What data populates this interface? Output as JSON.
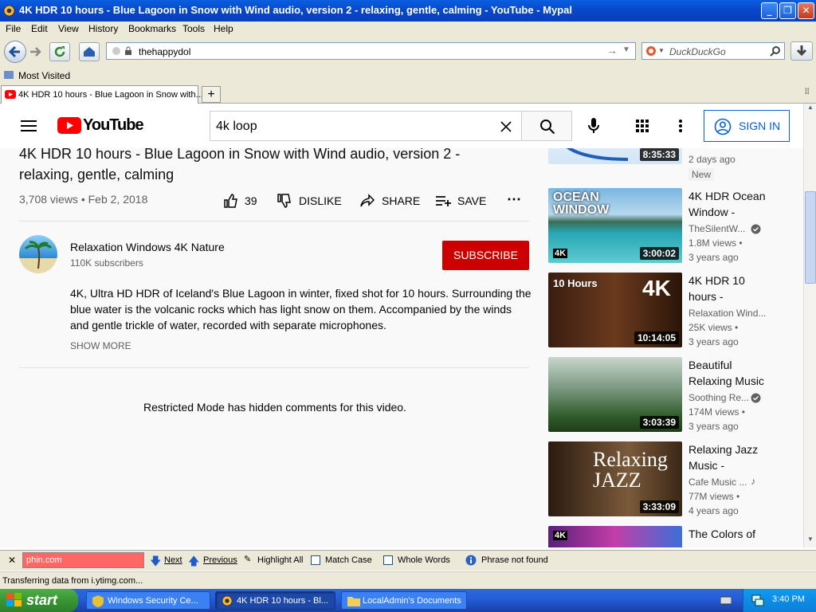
{
  "window": {
    "title": "4K HDR 10 hours - Blue Lagoon in Snow with Wind audio, version 2 - relaxing, gentle, calming - YouTube - Mypal"
  },
  "menu": [
    "File",
    "Edit",
    "View",
    "History",
    "Bookmarks",
    "Tools",
    "Help"
  ],
  "nav": {
    "url": "thehappydol",
    "search_placeholder": "DuckDuckGo"
  },
  "bookmarks": {
    "most_visited": "Most Visited"
  },
  "tabs": [
    {
      "label": "4K HDR 10 hours - Blue Lagoon in Snow with..."
    }
  ],
  "youtube": {
    "logo": "YouTube",
    "search_value": "4k loop",
    "signin": "SIGN IN",
    "video": {
      "title": "4K HDR 10 hours - Blue Lagoon in Snow with Wind audio, version 2 - relaxing, gentle, calming",
      "views": "3,708 views",
      "date": "Feb 2, 2018",
      "likes": "39",
      "dislike": "DISLIKE",
      "share": "SHARE",
      "save": "SAVE"
    },
    "channel": {
      "name": "Relaxation Windows 4K Nature",
      "subs": "110K subscribers",
      "subscribe": "SUBSCRIBE"
    },
    "description": {
      "line1": "4K, Ultra HD HDR of Iceland's Blue Lagoon in winter, fixed shot for 10 hours. Surrounding the",
      "line2": "blue water is the volcanic rocks which has light snow on them. Accompanied by the winds",
      "line3": "and gentle trickle of water, recorded with separate microphones.",
      "show_more": "SHOW MORE"
    },
    "comments_notice": "Restricted Mode has hidden comments for this video.",
    "sidebar": [
      {
        "title1": "",
        "title2": "",
        "channel": "",
        "views": "",
        "age": "2 days ago",
        "badge": "New",
        "duration": "8:35:33"
      },
      {
        "title1": "4K HDR Ocean",
        "title2": "Window -",
        "channel": "TheSilentW...",
        "views": "1.8M views •",
        "age": "3 years ago",
        "duration": "3:00:02",
        "thumb_text": "OCEAN WINDOW"
      },
      {
        "title1": "4K HDR 10",
        "title2": "hours -",
        "channel": "Relaxation Wind...",
        "views": "25K views •",
        "age": "3 years ago",
        "duration": "10:14:05",
        "thumb_text": "10 Hours"
      },
      {
        "title1": "Beautiful",
        "title2": "Relaxing Music",
        "channel": "Soothing Re...",
        "views": "174M views •",
        "age": "3 years ago",
        "duration": "3:03:39"
      },
      {
        "title1": "Relaxing Jazz",
        "title2": "Music -",
        "channel": "Cafe Music ...",
        "views": "77M views •",
        "age": "4 years ago",
        "duration": "3:33:09",
        "thumb_text": "Relaxing JAZZ"
      },
      {
        "title1": "The Colors of",
        "title2": "",
        "duration": ""
      }
    ]
  },
  "findbar": {
    "value": "phin.com",
    "next": "Next",
    "previous": "Previous",
    "highlight": "Highlight All",
    "match_case": "Match Case",
    "whole_words": "Whole Words",
    "status": "Phrase not found"
  },
  "status": "Transferring data from i.ytimg.com...",
  "taskbar": {
    "start": "start",
    "items": [
      "Windows Security Ce...",
      "4K HDR 10 hours - Bl...",
      "LocalAdmin's Documents"
    ],
    "clock": "3:40 PM"
  },
  "colors": {
    "subscribe": "#cc0000",
    "youtube_red": "#ff0000",
    "xp_blue": "#245edb"
  }
}
